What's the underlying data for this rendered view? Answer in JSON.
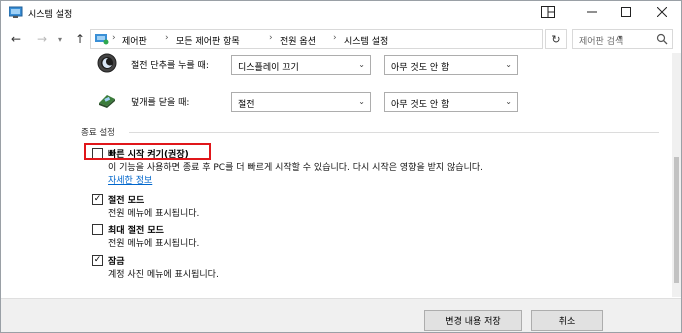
{
  "window": {
    "title": "시스템 설정",
    "icons": [
      "app-icon",
      "snap-layout-icon",
      "minimize-icon",
      "maximize-icon",
      "close-icon"
    ]
  },
  "address_bar": {
    "breadcrumbs": [
      "제어판",
      "모든 제어판 항목",
      "전원 옵션",
      "시스템 설정"
    ],
    "search_placeholder": "제어판 검색"
  },
  "power_buttons": [
    {
      "label": "절전 단추를 누를 때:",
      "icon": "sleep-button-icon",
      "battery": "디스플레이 끄기",
      "plugged": "아무 것도 안 함"
    },
    {
      "label": "덮개를 닫을 때:",
      "icon": "lid-close-icon",
      "battery": "절전",
      "plugged": "아무 것도 안 함"
    }
  ],
  "shutdown_settings": {
    "title": "종료 설정",
    "options": [
      {
        "title": "빠른 시작 켜기(권장)",
        "checked": false,
        "desc": "이 기능을 사용하면 종료 후 PC를 더 빠르게 시작할 수 있습니다. 다시 시작은 영향을 받지 않습니다.",
        "link": "자세한 정보"
      },
      {
        "title": "절전 모드",
        "checked": true,
        "desc": "전원 메뉴에 표시됩니다."
      },
      {
        "title": "최대 절전 모드",
        "checked": false,
        "desc": "전원 메뉴에 표시됩니다."
      },
      {
        "title": "잠금",
        "checked": true,
        "desc": "계정 사진 메뉴에 표시됩니다."
      }
    ]
  },
  "footer": {
    "save_label": "변경 내용 저장",
    "cancel_label": "취소"
  },
  "colors": {
    "highlight": "#e0161a",
    "link": "#0066cc"
  }
}
